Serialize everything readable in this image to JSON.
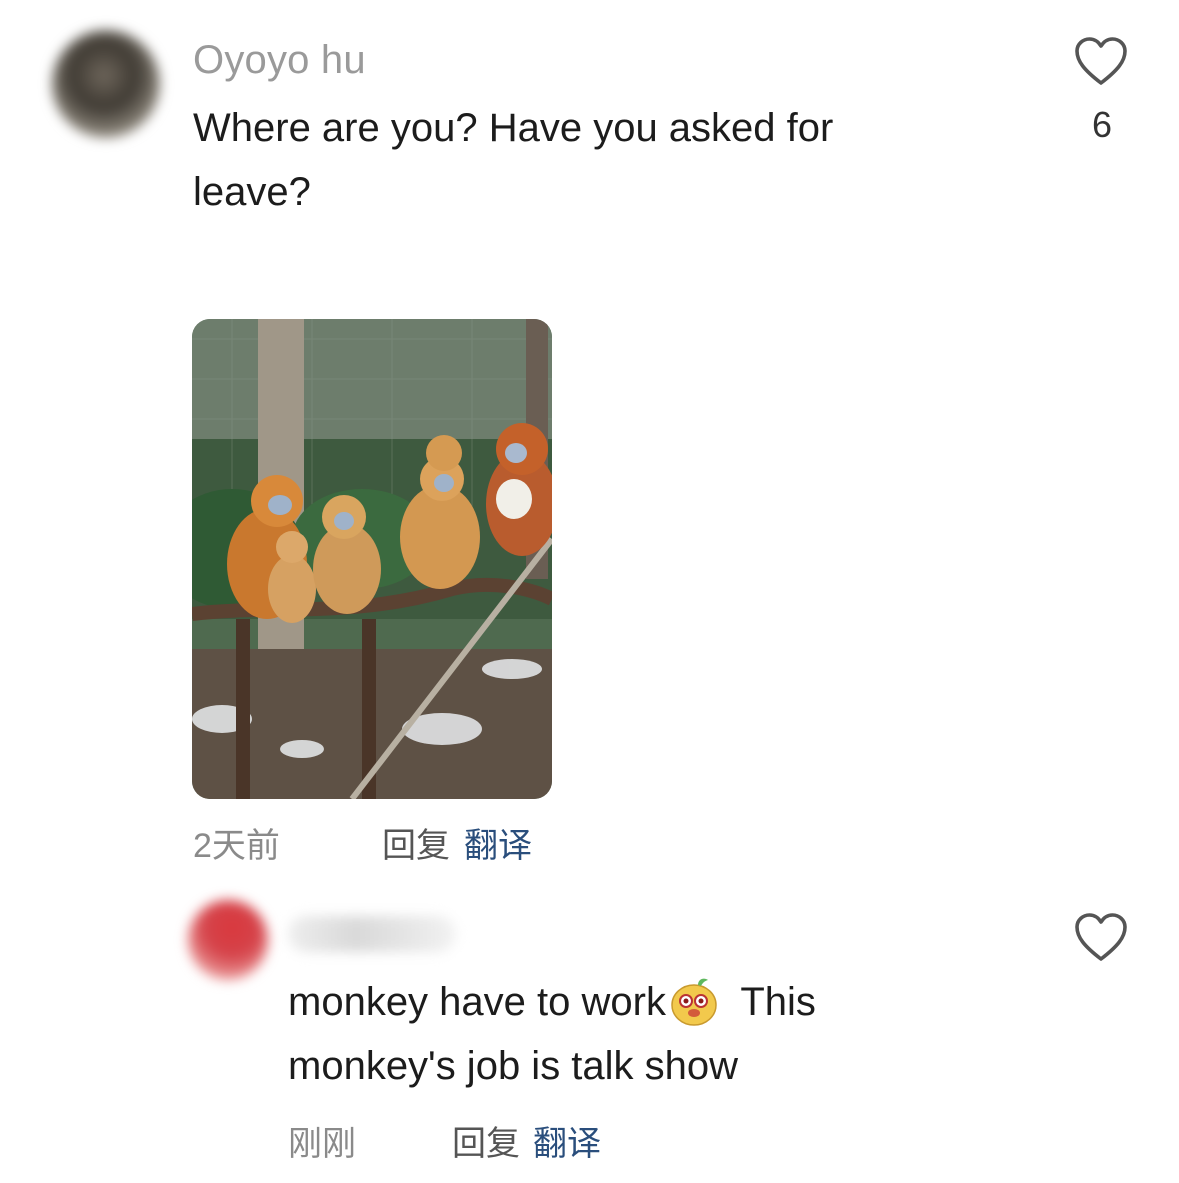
{
  "comments": [
    {
      "author": "Oyoyo hu",
      "text": "Where are you?  Have you asked for leave?",
      "likes": "6",
      "time": "2天前",
      "reply_label": "回复",
      "translate_label": "翻译",
      "has_image": true
    },
    {
      "author": "",
      "text_part1": "monkey have to work",
      "text_part2": " This monkey's job is talk show",
      "likes": "",
      "time": "刚刚",
      "reply_label": "回复",
      "translate_label": "翻译",
      "inline_emoji": "monkey-face-emoji"
    }
  ],
  "icons": {
    "like": "heart-outline-icon"
  },
  "colors": {
    "author": "#9a9a9a",
    "text": "#1c1c1c",
    "meta": "#8a8a8a",
    "translate": "#2a4e7c"
  }
}
